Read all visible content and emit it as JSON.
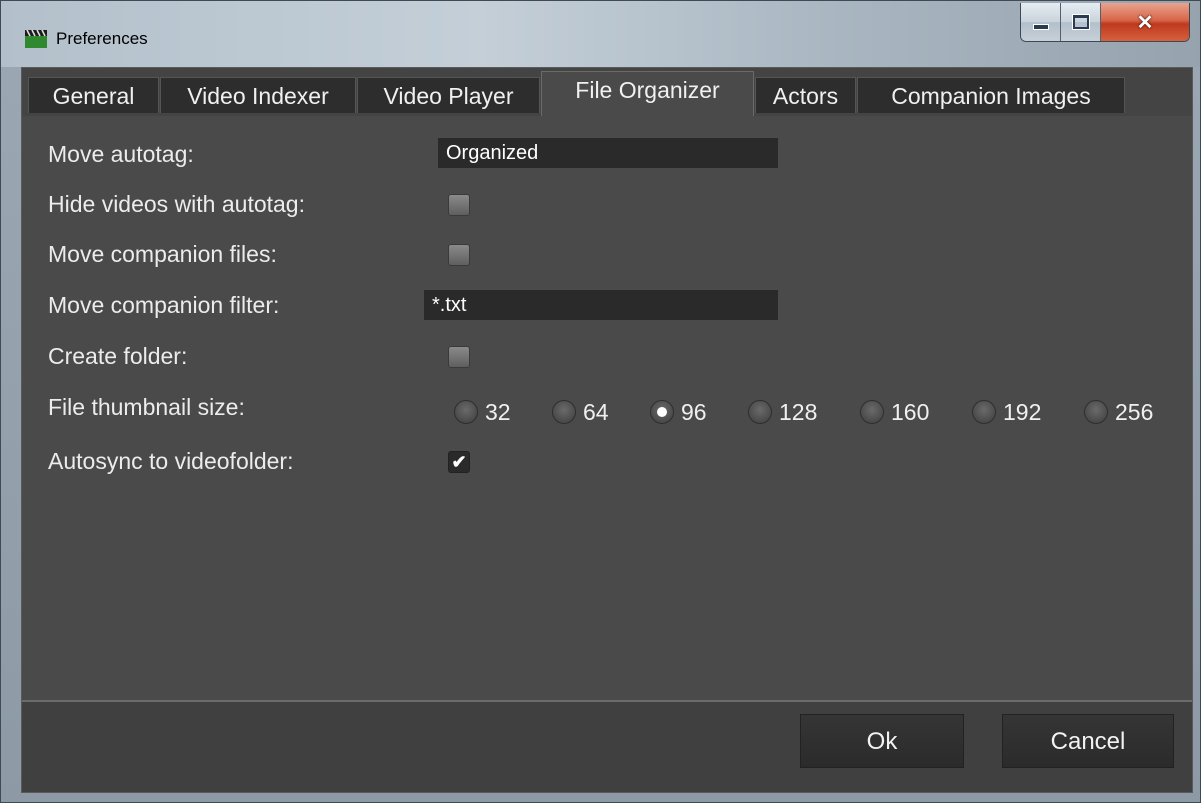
{
  "window": {
    "title": "Preferences"
  },
  "tabs": [
    {
      "label": "General"
    },
    {
      "label": "Video Indexer"
    },
    {
      "label": "Video Player"
    },
    {
      "label": "File Organizer",
      "active": true
    },
    {
      "label": "Actors"
    },
    {
      "label": "Companion Images"
    }
  ],
  "settings": {
    "move_autotag": {
      "label": "Move autotag:",
      "value": "Organized"
    },
    "hide_videos": {
      "label": "Hide videos with autotag:",
      "checked": false
    },
    "move_companion_files": {
      "label": "Move companion files:",
      "checked": false
    },
    "move_companion_filter": {
      "label": "Move companion filter:",
      "value": "*.txt"
    },
    "create_folder": {
      "label": "Create folder:",
      "checked": false
    },
    "thumbnail_size": {
      "label": "File thumbnail size:",
      "options": [
        "32",
        "64",
        "96",
        "128",
        "160",
        "192",
        "256"
      ],
      "selected": "96"
    },
    "autosync": {
      "label": "Autosync to videofolder:",
      "checked": true,
      "mark": "✔"
    }
  },
  "buttons": {
    "ok": "Ok",
    "cancel": "Cancel"
  },
  "icons": {
    "minimize": "minimize-icon",
    "maximize": "maximize-icon",
    "close": "close-icon",
    "app": "clapperboard-icon"
  },
  "colors": {
    "panel": "#4a4a4a",
    "tab_inactive": "#2d2d2d",
    "input_bg": "#2a2a2a",
    "close_button": "#c0391e"
  }
}
